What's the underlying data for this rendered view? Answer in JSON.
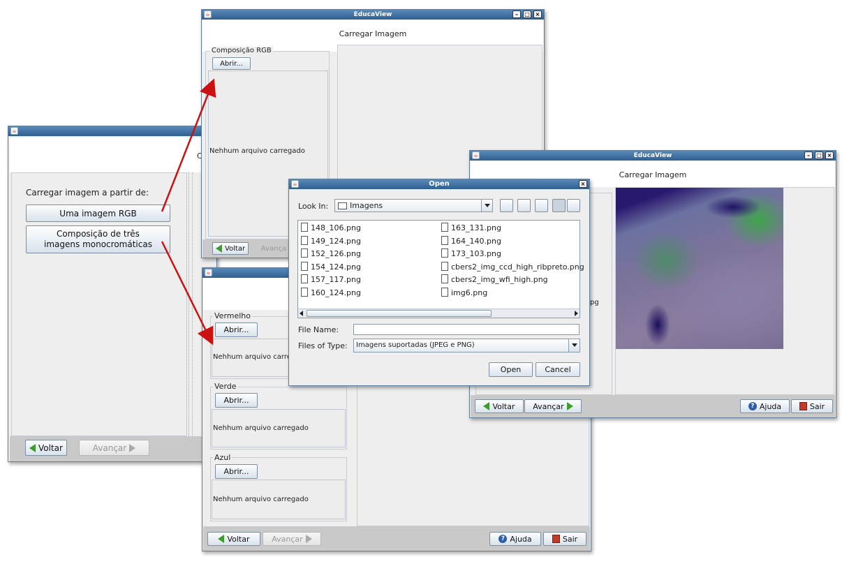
{
  "win1": {
    "prompt": "Carregar imagem a partir de:",
    "btn_rgb": "Uma imagem RGB",
    "btn_mono_line1": "Composição de três",
    "btn_mono_line2": "imagens monocromáticas",
    "back": "Voltar",
    "next": "Avançar",
    "header_fragment": "C"
  },
  "win2": {
    "title": "EducaView",
    "header": "Carregar Imagem",
    "group": "Composição RGB",
    "open": "Abrir...",
    "status": "Nehhum arquivo carregado",
    "back": "Voltar",
    "next": "Avança"
  },
  "win3": {
    "vermelho": "Vermelho",
    "verde": "Verde",
    "azul": "Azul",
    "open": "Abrir...",
    "status_red": "Nehhum arquivo carre",
    "status_green": "Nehhum arquivo carregado",
    "status_blue": "Nehhum arquivo carregado",
    "back": "Voltar",
    "next": "Avançar",
    "help": "Ajuda",
    "exit": "Sair"
  },
  "win4": {
    "title": "EducaView",
    "header": "Carregar Imagem",
    "fragment": "pg",
    "back": "Voltar",
    "next": "Avançar",
    "help": "Ajuda",
    "exit": "Sair"
  },
  "dialog": {
    "title": "Open",
    "look_in_label": "Look In:",
    "look_in_value": "Imagens",
    "files_left": [
      "148_106.png",
      "149_124.png",
      "152_126.png",
      "154_124.png",
      "157_117.png",
      "160_124.png"
    ],
    "files_right": [
      "163_131.png",
      "164_140.png",
      "173_103.png",
      "cbers2_img_ccd_high_ribpreto.png",
      "cbers2_img_wfi_high.png",
      "img6.png"
    ],
    "file_name_label": "File Name:",
    "file_name_value": "",
    "files_of_type_label": "Files of Type:",
    "files_of_type_value": "Imagens suportadas (JPEG e PNG)",
    "open_btn": "Open",
    "cancel_btn": "Cancel"
  },
  "colors": {
    "titlebar": "#3a6b9e",
    "arrow": "#cc1111",
    "accent_green": "#3c9d2c"
  }
}
